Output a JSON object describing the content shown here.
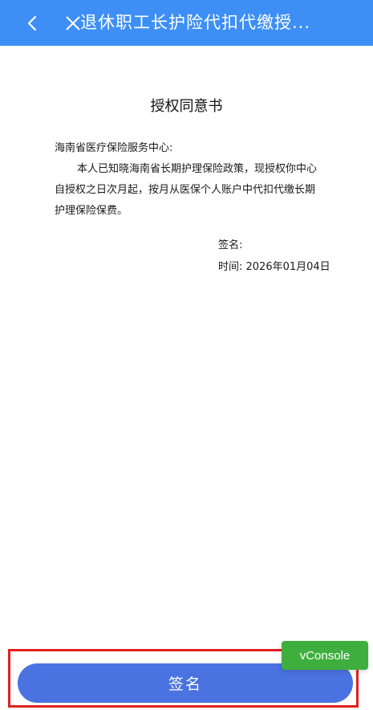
{
  "header": {
    "title": "退休职工长护险代扣代缴授...",
    "back_icon": "chevron-left-icon",
    "close_icon": "close-icon",
    "background": "#3d8ff5"
  },
  "document": {
    "title": "授权同意书",
    "addressee": "海南省医疗保险服务中心:",
    "paragraph": "本人已知晓海南省长期护理保险政策，现授权你中心自授权之日次月起，按月从医保个人账户中代扣代缴长期护理保险保费。",
    "signature_label": "签名:",
    "time_label": "时间: 2026年01月04日"
  },
  "footer": {
    "sign_button_label": "签名",
    "sign_button_color": "#4a72e0",
    "highlight_color": "#e0201e"
  },
  "vconsole": {
    "label": "vConsole",
    "color": "#3eaf3e"
  }
}
